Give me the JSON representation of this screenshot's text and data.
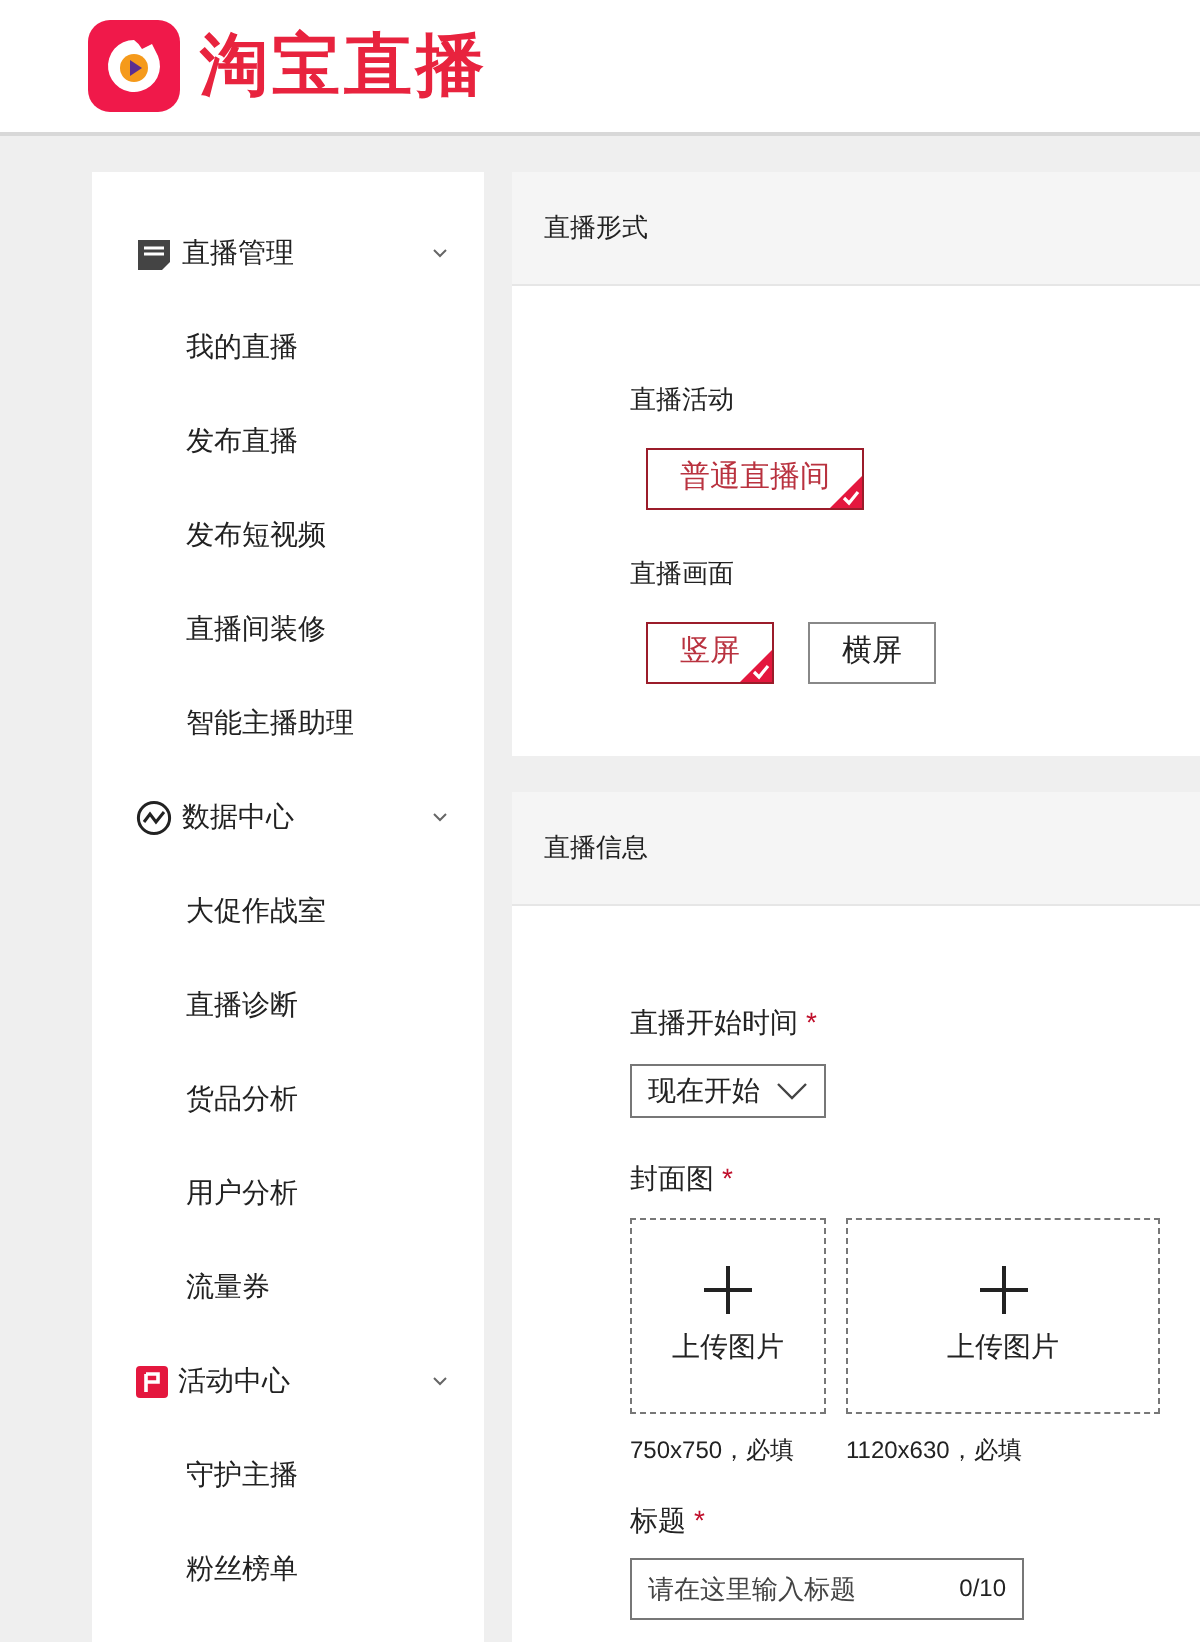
{
  "logo": {
    "text": "淘宝直播"
  },
  "sidebar": {
    "groups": [
      {
        "kind": "document",
        "label": "直播管理",
        "expanded": true,
        "items": [
          "我的直播",
          "发布直播",
          "发布短视频",
          "直播间装修",
          "智能主播助理"
        ]
      },
      {
        "kind": "chart",
        "label": "数据中心",
        "expanded": true,
        "items": [
          "大促作战室",
          "直播诊断",
          "货品分析",
          "用户分析",
          "流量券"
        ]
      },
      {
        "kind": "flag",
        "label": "活动中心",
        "expanded": true,
        "items": [
          "守护主播",
          "粉丝榜单"
        ]
      }
    ]
  },
  "live_format": {
    "title": "直播形式",
    "activity": {
      "label": "直播活动",
      "options": [
        {
          "label": "普通直播间",
          "selected": true
        }
      ]
    },
    "screen": {
      "label": "直播画面",
      "options": [
        {
          "label": "竖屏",
          "selected": true
        },
        {
          "label": "横屏",
          "selected": false
        }
      ]
    }
  },
  "live_info": {
    "title": "直播信息",
    "start_time": {
      "label": "直播开始时间",
      "required_mark": "*",
      "value": "现在开始"
    },
    "cover": {
      "label": "封面图",
      "required_mark": "*",
      "uploads": [
        {
          "label": "上传图片",
          "hint": "750x750，必填"
        },
        {
          "label": "上传图片",
          "hint": "1120x630，必填"
        }
      ]
    },
    "title_field": {
      "label": "标题",
      "required_mark": "*",
      "placeholder": "请在这里输入标题",
      "counter": "0/10"
    }
  }
}
